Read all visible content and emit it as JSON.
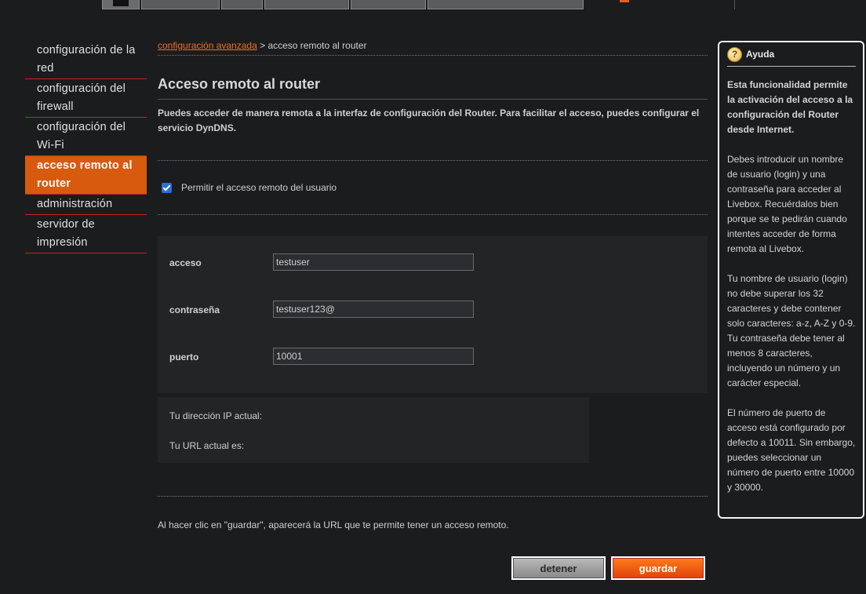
{
  "sidebar": {
    "items": [
      {
        "label": "configuración de la red"
      },
      {
        "label": "configuración del firewall"
      },
      {
        "label": "configuración del Wi-Fi"
      },
      {
        "label": "acceso remoto al router"
      },
      {
        "label": "administración"
      },
      {
        "label": "servidor de impresión"
      }
    ],
    "active_index": 3
  },
  "breadcrumb": {
    "link": "configuración avanzada",
    "separator": " > ",
    "current": "acceso remoto al router"
  },
  "page": {
    "title": "Acceso remoto al router",
    "intro": "Puedes acceder de manera remota a la interfaz de configuración del Router. Para facilitar el acceso, puedes configurar el servicio DynDNS."
  },
  "remote_access": {
    "checkbox_label": "Permitir el acceso remoto del usuario",
    "checked": true
  },
  "form": {
    "login_label": "acceso",
    "login_value": "testuser",
    "password_label": "contraseña",
    "password_value": "testuser123@",
    "port_label": "puerto",
    "port_value": "10001"
  },
  "info": {
    "ip_label": "Tu dirección IP actual:",
    "url_label": "Tu URL actual es:"
  },
  "note": "Al hacer clic en \"guardar\", aparecerá la URL que te permite tener un acceso remoto.",
  "buttons": {
    "stop": "detener",
    "save": "guardar"
  },
  "help": {
    "title": "Ayuda",
    "intro": "Esta funcionalidad permite la activación del acceso a la configuración del Router desde Internet.",
    "p1": "Debes introducir un nombre de usuario (login) y una contraseña para acceder al Livebox. Recuérdalos bien porque se te pedirán cuando intentes acceder de forma remota al Livebox.",
    "p2": "Tu nombre de usuario (login) no debe superar los 32 caracteres y debe contener solo caracteres: a-z, A-Z y 0-9. Tu contraseña debe tener al menos 8 caracteres, incluyendo un número y un carácter especial.",
    "p3": "El número de puerto de acceso está configurado por defecto a 10011. Sin embargo, puedes seleccionar un número de puerto entre 10000 y 30000."
  },
  "colors": {
    "accent": "#d75a0f",
    "link": "#f07020",
    "divider": "#c2242a",
    "checkbox": "#2b6fd6"
  }
}
